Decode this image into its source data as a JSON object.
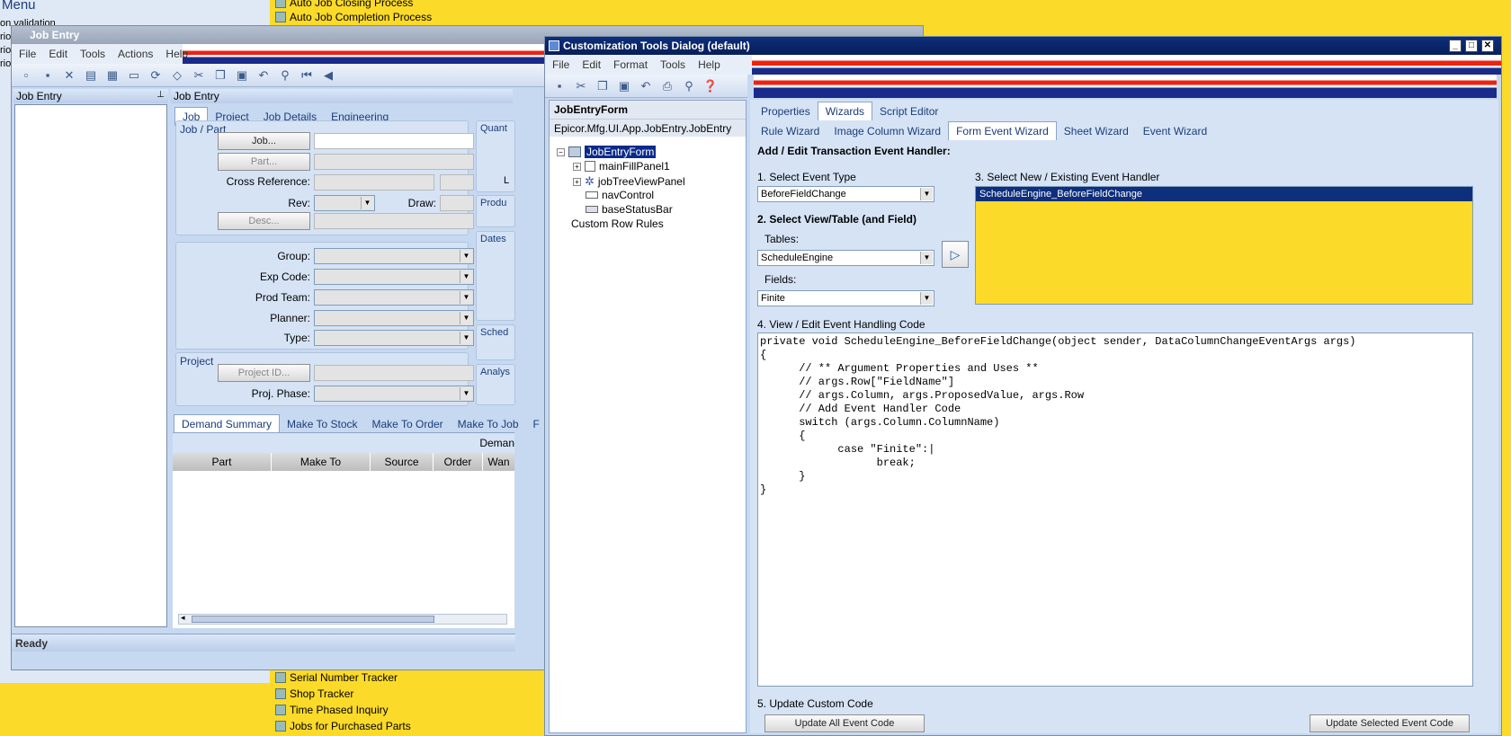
{
  "bg_menu": {
    "title": "Menu",
    "left_items": [
      "on validation",
      "rio",
      "rio",
      "rio"
    ],
    "top_items": [
      "Auto Job Closing Process",
      "Auto Job Completion Process"
    ],
    "bottom_items": [
      "Serial Number Tracker",
      "Shop Tracker",
      "Time Phased Inquiry",
      "Jobs for Purchased Parts"
    ]
  },
  "job_entry": {
    "title": "Job Entry",
    "menu": [
      "File",
      "Edit",
      "Tools",
      "Actions",
      "Help"
    ],
    "tree_header": "Job Entry",
    "main_header": "Job Entry",
    "tabs": [
      "Job",
      "Project",
      "Job Details",
      "Engineering"
    ],
    "group_job_part": "Job / Part",
    "btn_job": "Job...",
    "btn_part": "Part...",
    "lbl_cross_ref": "Cross Reference:",
    "lbl_rev": "Rev:",
    "lbl_draw": "Draw:",
    "btn_desc": "Desc...",
    "lbl_group": "Group:",
    "lbl_exp_code": "Exp Code:",
    "lbl_prod_team": "Prod Team:",
    "lbl_planner": "Planner:",
    "lbl_type": "Type:",
    "group_project": "Project",
    "btn_project_id": "Project ID...",
    "lbl_proj_phase": "Proj. Phase:",
    "right_groups": [
      "Quant",
      "Produ",
      "Dates",
      "Sched",
      "Analys"
    ],
    "right_l": "L",
    "bottom_tabs": [
      "Demand Summary",
      "Make To Stock",
      "Make To Order",
      "Make To Job",
      "F"
    ],
    "demand_label": "Deman",
    "grid_cols": [
      "Part",
      "Make To",
      "Source",
      "Order",
      "Wan"
    ],
    "status": "Ready"
  },
  "custom_dialog": {
    "title": "Customization Tools Dialog (default)",
    "menu": [
      "File",
      "Edit",
      "Format",
      "Tools",
      "Help"
    ],
    "tree_title": "JobEntryForm",
    "tree_sub": "Epicor.Mfg.UI.App.JobEntry.JobEntry",
    "tree": [
      "JobEntryForm",
      "mainFillPanel1",
      "jobTreeViewPanel",
      "navControl",
      "baseStatusBar",
      "Custom Row Rules"
    ],
    "tabs_top": [
      "Properties",
      "Wizards",
      "Script Editor"
    ],
    "tabs_wiz": [
      "Rule Wizard",
      "Image Column Wizard",
      "Form Event Wizard",
      "Sheet Wizard",
      "Event Wizard"
    ],
    "section_title": "Add / Edit Transaction Event Handler:",
    "step1": "1. Select Event Type",
    "event_type": "BeforeFieldChange",
    "step2": "2. Select View/Table (and Field)",
    "tables_label": "Tables:",
    "table_value": "ScheduleEngine",
    "fields_label": "Fields:",
    "field_value": "Finite",
    "step3": "3. Select New / Existing Event Handler",
    "handler": "ScheduleEngine_BeforeFieldChange",
    "step4": "4. View / Edit Event Handling Code",
    "code": "private void ScheduleEngine_BeforeFieldChange(object sender, DataColumnChangeEventArgs args)\n{\n      // ** Argument Properties and Uses **\n      // args.Row[\"FieldName\"]\n      // args.Column, args.ProposedValue, args.Row\n      // Add Event Handler Code\n      switch (args.Column.ColumnName)\n      {\n            case \"Finite\":|\n                  break;\n      }\n}",
    "step5": "5. Update Custom Code",
    "btn_update_all": "Update All Event Code",
    "btn_update_sel": "Update Selected Event Code"
  }
}
